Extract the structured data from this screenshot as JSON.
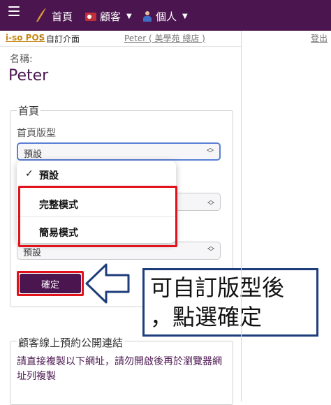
{
  "nav": {
    "home": "首頁",
    "customers": "顧客",
    "personal": "個人"
  },
  "breadcrumb": {
    "app": "i-so POS",
    "separator": ":",
    "page": "自訂介面"
  },
  "user": {
    "link": "Peter ( 美學苑 總店 )",
    "logout": "登出"
  },
  "profile": {
    "name_label": "名稱:",
    "name_value": "Peter"
  },
  "home_section": {
    "legend": "首頁",
    "field_label": "首頁版型",
    "selected_value": "預設",
    "options": [
      {
        "label": "預設",
        "checked": true
      },
      {
        "label": "完整模式",
        "checked": false
      },
      {
        "label": "簡易模式",
        "checked": false
      }
    ],
    "select3_value": "預設",
    "confirm_label": "確定"
  },
  "annotation": {
    "line1": "可自訂版型後",
    "line2": "，點選確定"
  },
  "booking_section": {
    "legend": "顧客線上預約公開連結",
    "note": "請直接複製以下網址，請勿開啟後再於瀏覽器網址列複製"
  },
  "colors": {
    "brand": "#4b1650",
    "highlight": "#e0121a",
    "callout_border": "#1e3d7b"
  }
}
